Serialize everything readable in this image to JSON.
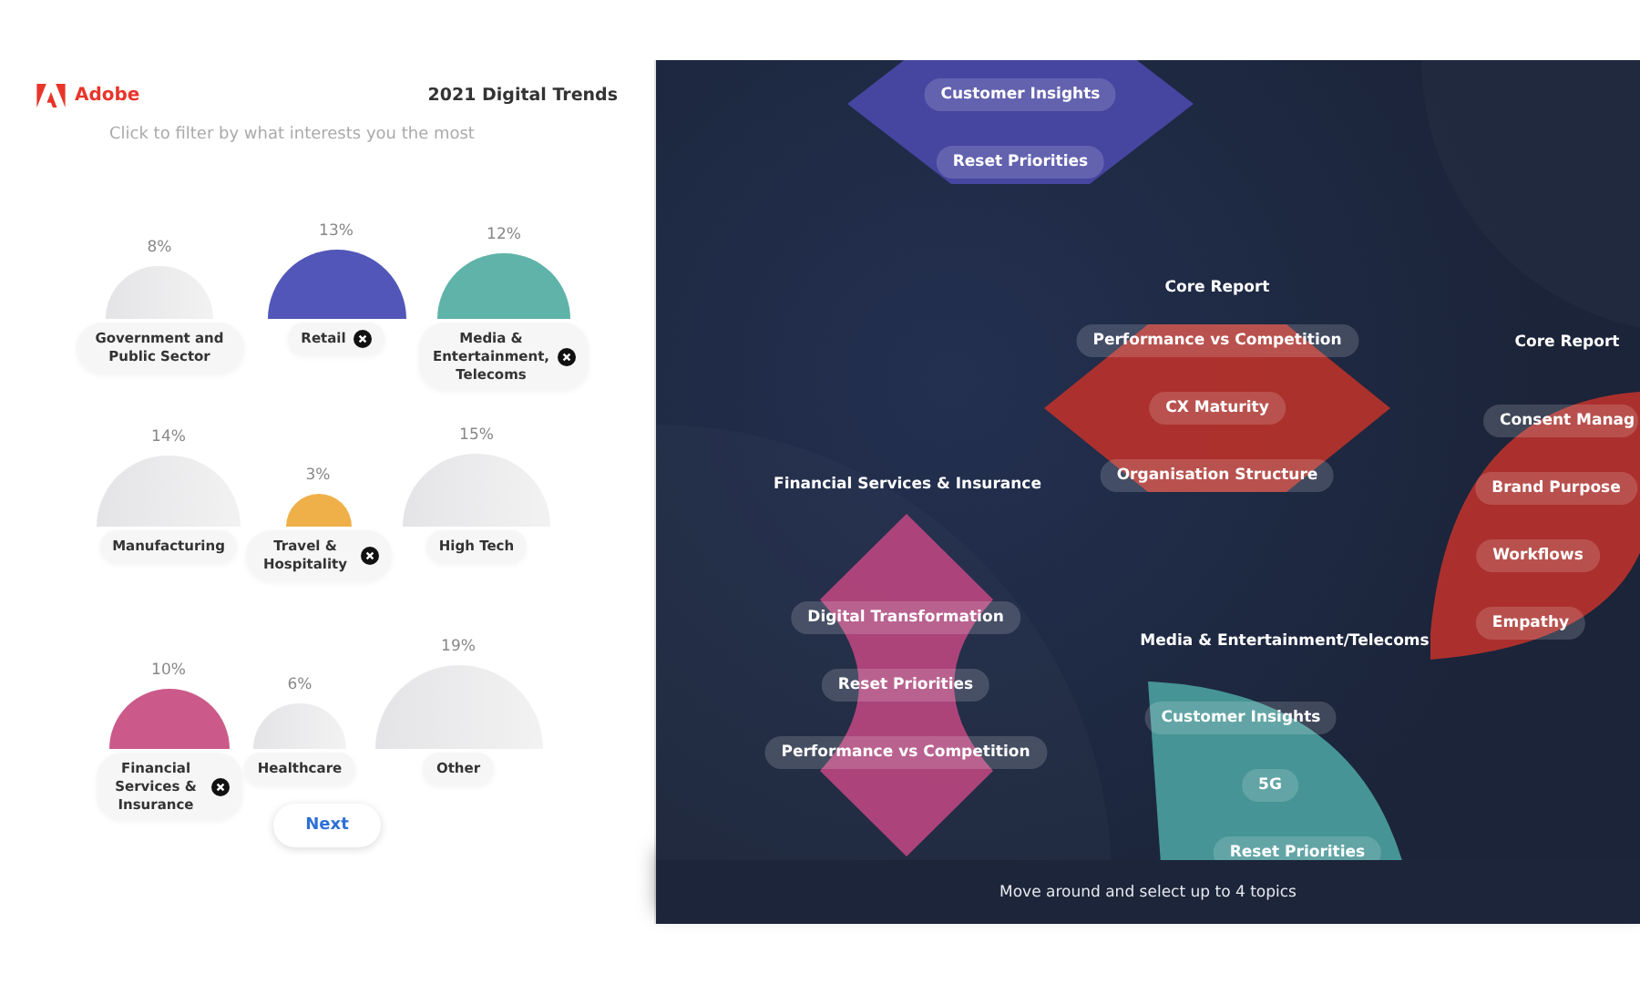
{
  "header": {
    "brand": "Adobe",
    "title": "2021 Digital Trends"
  },
  "filter": {
    "instruction": "Click to filter by what interests you the most",
    "rows": [
      [
        {
          "label": "Government and Public Sector",
          "percent": "8%",
          "selected": false
        },
        {
          "label": "Retail",
          "percent": "13%",
          "selected": true,
          "color": "#5256b8"
        },
        {
          "label": "Media & Entertainment, Telecoms",
          "percent": "12%",
          "selected": true,
          "color": "#5fb3a8"
        }
      ],
      [
        {
          "label": "Manufacturing",
          "percent": "14%",
          "selected": false
        },
        {
          "label": "Travel & Hospitality",
          "percent": "3%",
          "selected": true,
          "color": "#f0b049"
        },
        {
          "label": "High Tech",
          "percent": "15%",
          "selected": false
        }
      ],
      [
        {
          "label": "Financial Services & Insurance",
          "percent": "10%",
          "selected": true,
          "color": "#cb5a8a"
        },
        {
          "label": "Healthcare",
          "percent": "6%",
          "selected": false
        },
        {
          "label": "Other",
          "percent": "19%",
          "selected": false
        }
      ]
    ],
    "next_button": "Next"
  },
  "map": {
    "clusters": [
      {
        "kind": "diamond",
        "color": "#4a48a8",
        "topics": [
          "Customer Insights",
          "Reset Priorities"
        ]
      },
      {
        "kind": "diamond",
        "title": "Core Report",
        "color": "#b8322c",
        "topics": [
          "Performance vs Competition",
          "CX Maturity",
          "Organisation Structure"
        ]
      },
      {
        "kind": "leaf",
        "title": "Core Report",
        "color": "#b8322c",
        "topics": [
          "Consent Manag",
          "Brand Purpose",
          "Workflows",
          "Empathy"
        ]
      },
      {
        "kind": "hourglass",
        "title": "Financial Services & Insurance",
        "color": "#b8467f",
        "topics": [
          "Digital Transformation",
          "Reset Priorities",
          "Performance vs Competition"
        ]
      },
      {
        "kind": "fan",
        "title": "Media & Entertainment/Telecoms",
        "color": "#4a9e9e",
        "topics": [
          "Customer Insights",
          "5G",
          "Reset Priorities"
        ]
      }
    ],
    "footer": "Move around and select up to 4 topics"
  }
}
